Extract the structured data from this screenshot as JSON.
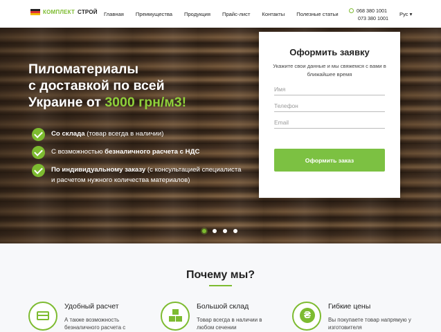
{
  "header": {
    "logo": {
      "part1": "КОМПЛЕКТ",
      "part2": "СТРОЙ"
    },
    "nav": [
      "Главная",
      "Преимущества",
      "Продукция",
      "Прайс-лист",
      "Контакты",
      "Полезные статьи"
    ],
    "phones": [
      "068 380 1001",
      "073 380 1001"
    ],
    "language": "Рус ▾"
  },
  "hero": {
    "title_line1": "Пиломатериалы",
    "title_line2": "с доставкой по всей",
    "title_line3_prefix": "Украине от ",
    "title_price": "3000 грн/м3!",
    "features": [
      {
        "bold": "Со склада",
        "text": " (товар всегда в наличии)"
      },
      {
        "prefix": "С возможностью ",
        "bold": "безналичного расчета с НДС",
        "text": ""
      },
      {
        "bold": "По индивидуальному заказу",
        "text": " (с консультацией специалиста и расчетом нужного количества материалов)"
      }
    ],
    "slider_total": 4,
    "slider_active": 1
  },
  "form": {
    "title": "Оформить заявку",
    "subtitle": "Укажите свои данные и мы свяжемся с вами в ближайшее время",
    "name_placeholder": "Имя",
    "phone_placeholder": "Телефон",
    "email_placeholder": "Email",
    "submit_label": "Оформить заказ"
  },
  "why": {
    "title": "Почему мы?",
    "items": [
      {
        "title": "Удобный расчет",
        "text": "А также возможность безналичного расчета с"
      },
      {
        "title": "Большой склад",
        "text": "Товар всегда в наличии в любом сечении"
      },
      {
        "title": "Гибкие цены",
        "text": "Вы покупаете товар напрямую у изготовителя"
      }
    ]
  },
  "colors": {
    "accent": "#7dbb30",
    "button": "#7cc142"
  },
  "icons": [
    "phone-icon",
    "check-icon",
    "card-icon",
    "boxes-icon",
    "hryvnia-icon"
  ]
}
